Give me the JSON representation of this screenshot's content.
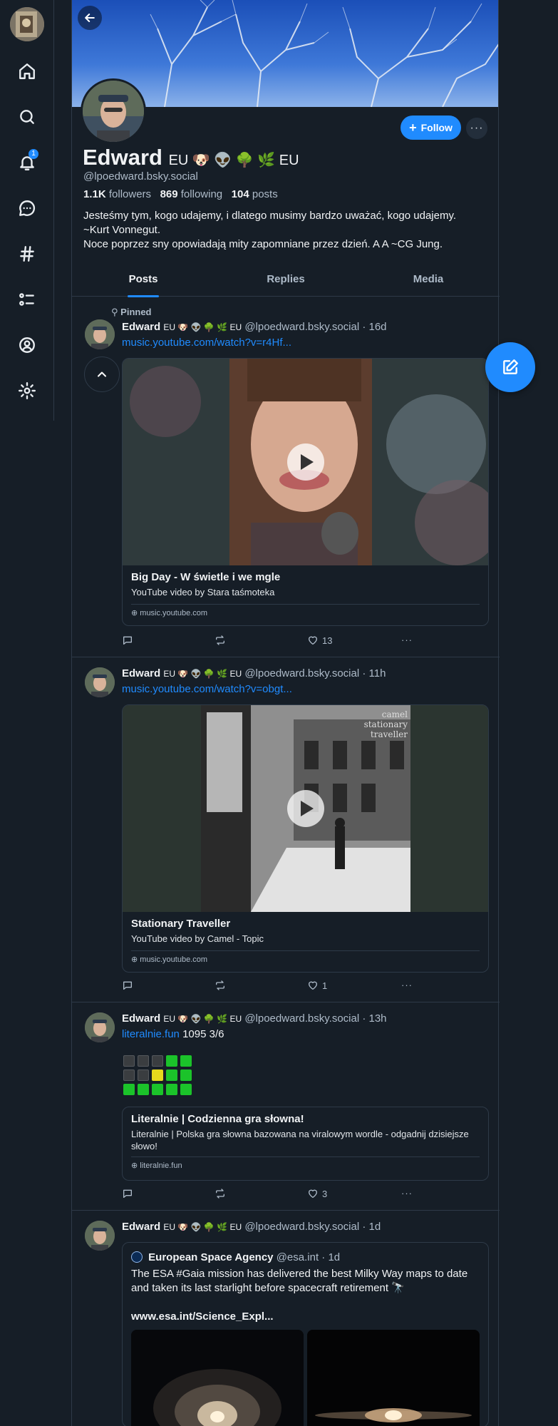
{
  "nav": {
    "notification_count": "1"
  },
  "profile": {
    "name": "Edward",
    "name_suffix": "EU 🐶 👽 🌳 🌿 EU",
    "handle": "@lpoedward.bsky.social",
    "followers_count": "1.1K",
    "followers_label": "followers",
    "following_count": "869",
    "following_label": "following",
    "posts_count": "104",
    "posts_label": "posts",
    "bio_line1": "Jesteśmy tym, kogo udajemy, i dlatego musimy bardzo uważać, kogo udajemy.",
    "bio_line2": "~Kurt Vonnegut.",
    "bio_line3": "Noce poprzez sny opowiadają mity zapomniane przez dzień. A A ~CG Jung.",
    "follow_label": "Follow",
    "more_label": "···"
  },
  "tabs": [
    "Posts",
    "Replies",
    "Media"
  ],
  "pinned_label": "Pinned",
  "posts": [
    {
      "author": "Edward",
      "emojis": "EU 🐶 👽 🌳 🌿 EU",
      "handle_time": "@lpoedward.bsky.social · 16d",
      "link": "music.youtube.com/watch?v=r4Hf...",
      "card_title": "Big Day -  W świetle i we mgle",
      "card_desc": "YouTube video by Stara taśmoteka",
      "card_domain": "music.youtube.com",
      "replies": "",
      "reposts": "",
      "likes": "13"
    },
    {
      "author": "Edward",
      "emojis": "EU 🐶 👽 🌳 🌿 EU",
      "handle_time": "@lpoedward.bsky.social · 11h",
      "link": "music.youtube.com/watch?v=obgt...",
      "card_title": "Stationary Traveller",
      "card_desc": "YouTube video by Camel - Topic",
      "card_domain": "music.youtube.com",
      "thumb_text": "camel stationary traveller",
      "replies": "",
      "reposts": "",
      "likes": "1"
    },
    {
      "author": "Edward",
      "emojis": "EU 🐶 👽 🌳 🌿 EU",
      "handle_time": "@lpoedward.bsky.social · 13h",
      "link": "literalnie.fun",
      "text_after_link": "1095 3/6",
      "card_title": "Literalnie | Codzienna gra słowna!",
      "card_desc": "Literalnie | Polska gra słowna bazowana na viralowym wordle - odgadnij dzisiejsze słowo!",
      "card_domain": "literalnie.fun",
      "grid": [
        [
          "d",
          "d",
          "d",
          "g",
          "g"
        ],
        [
          "d",
          "d",
          "y",
          "g",
          "g"
        ],
        [
          "g",
          "g",
          "g",
          "g",
          "g"
        ]
      ],
      "replies": "",
      "reposts": "",
      "likes": "3"
    },
    {
      "author": "Edward",
      "emojis": "EU 🐶 👽 🌳 🌿 EU",
      "handle_time": "@lpoedward.bsky.social · 1d",
      "quote_author": "European Space Agency",
      "quote_handle_time": "@esa.int · 1d",
      "quote_text": "The ESA #Gaia mission has delivered the best Milky Way maps to date and taken its last starlight before spacecraft retirement 🔭",
      "quote_link": "www.esa.int/Science_Expl..."
    }
  ]
}
